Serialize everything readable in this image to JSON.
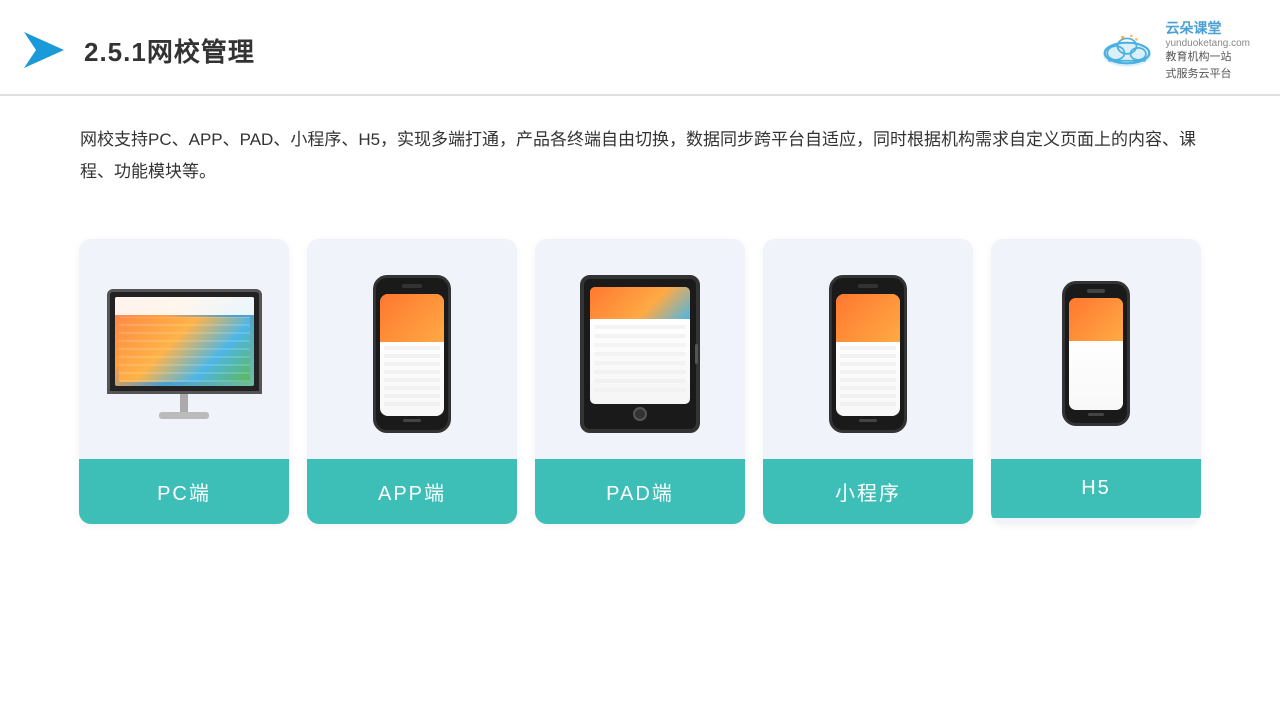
{
  "header": {
    "title": "2.5.1网校管理",
    "brand": {
      "name": "云朵课堂",
      "url": "yunduoketang.com",
      "tagline": "教育机构一站\n式服务云平台"
    }
  },
  "description": {
    "text": "网校支持PC、APP、PAD、小程序、H5，实现多端打通，产品各终端自由切换，数据同步跨平台自适应，同时根据机构需求自定义页面上的内容、课程、功能模块等。"
  },
  "cards": [
    {
      "id": "pc",
      "label": "PC端"
    },
    {
      "id": "app",
      "label": "APP端"
    },
    {
      "id": "pad",
      "label": "PAD端"
    },
    {
      "id": "mini",
      "label": "小程序"
    },
    {
      "id": "h5",
      "label": "H5"
    }
  ],
  "colors": {
    "accent": "#3dbfb8",
    "title": "#333333",
    "text": "#333333",
    "card_bg": "#f0f4fa"
  }
}
